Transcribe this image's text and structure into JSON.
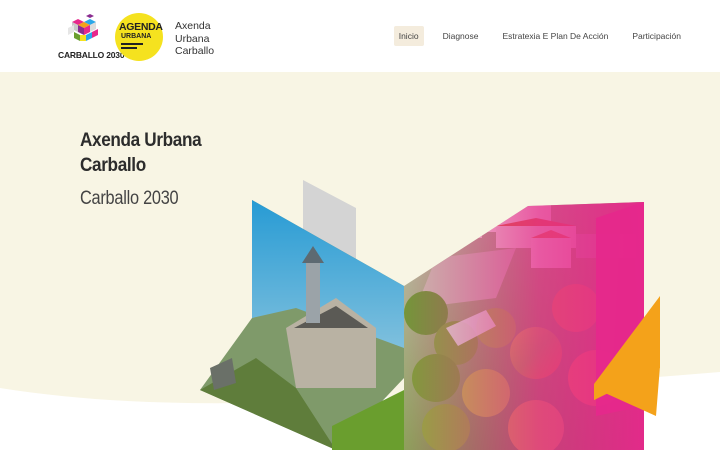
{
  "header": {
    "logo_c2030": {
      "label": "CARBALLO 2030"
    },
    "logo_agenda": {
      "line1": "AGENDA",
      "line2": "URBANA"
    },
    "site_title": {
      "line1": "Axenda",
      "line2": "Urbana",
      "line3": "Carballo"
    },
    "nav": [
      {
        "label": "Inicio",
        "active": true
      },
      {
        "label": "Diagnose",
        "active": false
      },
      {
        "label": "Estratexia E Plan De Acción",
        "active": false
      },
      {
        "label": "Participación",
        "active": false
      }
    ]
  },
  "hero": {
    "title_line1": "Axenda Urbana",
    "title_line2": "Carballo",
    "subtitle": "Carballo 2030"
  },
  "colors": {
    "background": "#f8f5e4",
    "header": "#ffffff",
    "blue": "#2aa7e8",
    "magenta": "#e6288c",
    "orange": "#f4a21a",
    "green": "#6a9e2e",
    "grey": "#cfcfcf",
    "yellow": "#f5e21f"
  }
}
